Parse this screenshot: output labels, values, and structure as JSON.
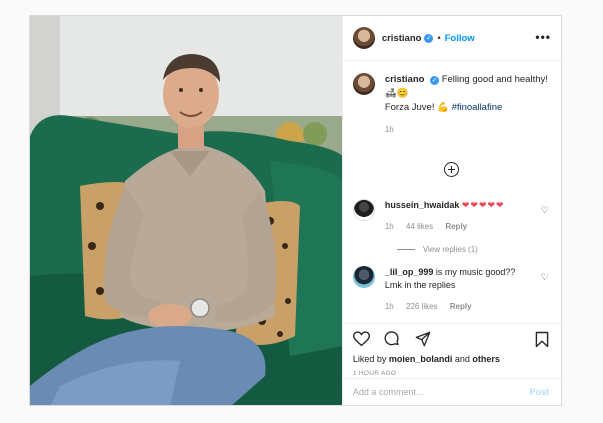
{
  "header": {
    "username": "cristiano",
    "verified_icon": "check-badge-icon",
    "dot": "•",
    "follow_label": "Follow",
    "more_icon": "more-horizontal-icon",
    "more_glyph": "•••"
  },
  "caption": {
    "username": "cristiano",
    "line1": "Felling good and healthy!",
    "emoji_line": "🛋😊",
    "line3_prefix": "Forza Juve! 💪 ",
    "hashtag": "#finoallafine",
    "time": "1h"
  },
  "load_more_icon": "plus-circle-icon",
  "comments": [
    {
      "username": "hussein_hwaidak",
      "text": "❤❤❤❤❤",
      "time": "1h",
      "likes": "44 likes",
      "reply_label": "Reply",
      "view_replies": "View replies (1)"
    },
    {
      "username": "_lil_op_999",
      "text": "is my music good?? Lmk in the replies",
      "time": "1h",
      "likes": "226 likes",
      "reply_label": "Reply"
    }
  ],
  "actions": {
    "like_icon": "heart-icon",
    "comment_icon": "comment-icon",
    "share_icon": "paper-plane-icon",
    "save_icon": "bookmark-icon",
    "liked_by_prefix": "Liked by ",
    "liked_by_user": "moien_bolandi",
    "liked_by_and": " and ",
    "liked_by_others": "others",
    "time_ago": "1 HOUR AGO"
  },
  "add_comment": {
    "placeholder": "Add a comment...",
    "post_label": "Post"
  },
  "colors": {
    "accent": "#0095f6",
    "heart": "#ed4956",
    "sofa": "#1b6b4e"
  }
}
